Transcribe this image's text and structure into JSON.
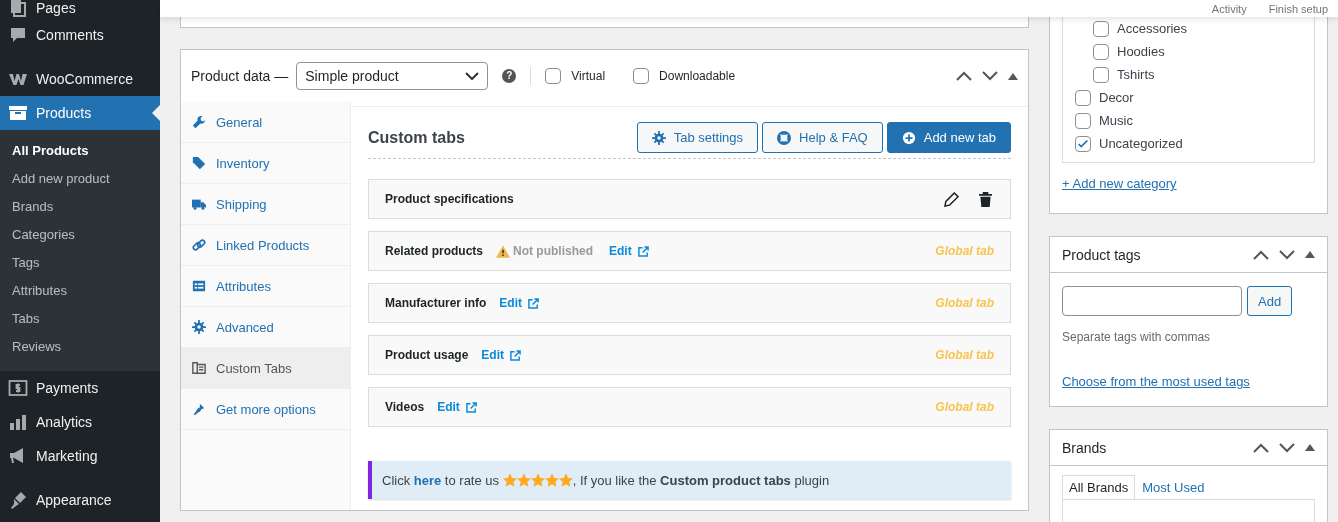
{
  "top_bar": {
    "links": [
      "Activity",
      "Finish setup"
    ]
  },
  "sidebar": {
    "items": [
      {
        "label": "Pages",
        "selected": false
      },
      {
        "label": "Comments",
        "selected": false
      },
      {
        "label": "WooCommerce",
        "selected": false
      },
      {
        "label": "Products",
        "selected": true,
        "children": [
          {
            "label": "All Products",
            "selected": true
          },
          {
            "label": "Add new product",
            "selected": false
          },
          {
            "label": "Brands",
            "selected": false
          },
          {
            "label": "Categories",
            "selected": false
          },
          {
            "label": "Tags",
            "selected": false
          },
          {
            "label": "Attributes",
            "selected": false
          },
          {
            "label": "Tabs",
            "selected": false
          },
          {
            "label": "Reviews",
            "selected": false
          }
        ]
      },
      {
        "label": "Payments",
        "selected": false
      },
      {
        "label": "Analytics",
        "selected": false
      },
      {
        "label": "Marketing",
        "selected": false
      },
      {
        "label": "Appearance",
        "selected": false
      }
    ]
  },
  "product_data": {
    "title": "Product data —",
    "product_type": "Simple product",
    "help_icon": "?",
    "options": [
      {
        "label": "Virtual",
        "checked": false
      },
      {
        "label": "Downloadable",
        "checked": false
      }
    ],
    "tabs": [
      {
        "label": "General",
        "selected": false
      },
      {
        "label": "Inventory",
        "selected": false
      },
      {
        "label": "Shipping",
        "selected": false
      },
      {
        "label": "Linked Products",
        "selected": false
      },
      {
        "label": "Attributes",
        "selected": false
      },
      {
        "label": "Advanced",
        "selected": false
      },
      {
        "label": "Custom Tabs",
        "selected": true
      },
      {
        "label": "Get more options",
        "selected": false
      }
    ],
    "panel": {
      "title": "Custom tabs",
      "buttons": [
        {
          "label": "Tab settings",
          "kind": "secondary"
        },
        {
          "label": "Help & FAQ",
          "kind": "secondary"
        },
        {
          "label": "Add new tab",
          "kind": "primary"
        }
      ],
      "custom_tabs": [
        {
          "name": "Product specifications",
          "kind": "local"
        },
        {
          "name": "Related products",
          "kind": "global",
          "status": "Not published",
          "edit": "Edit",
          "scope": "Global tab"
        },
        {
          "name": "Manufacturer info",
          "kind": "global",
          "edit": "Edit",
          "scope": "Global tab"
        },
        {
          "name": "Product usage",
          "kind": "global",
          "edit": "Edit",
          "scope": "Global tab"
        },
        {
          "name": "Videos",
          "kind": "global",
          "edit": "Edit",
          "scope": "Global tab"
        }
      ],
      "notice": {
        "before": "Click",
        "link": "here",
        "middle": "to rate us",
        "stars": 5,
        "after": ", If you like the **Custom product tabs** plugin"
      }
    }
  },
  "categories": {
    "items": [
      {
        "children": [
          {
            "label": "Accessories",
            "checked": false
          },
          {
            "label": "Hoodies",
            "checked": false
          },
          {
            "label": "Tshirts",
            "checked": false
          }
        ]
      },
      {
        "label": "Decor",
        "checked": false
      },
      {
        "label": "Music",
        "checked": false
      },
      {
        "label": "Uncategorized",
        "checked": true
      }
    ],
    "add_link": "+ Add new category"
  },
  "product_tags": {
    "title": "Product tags",
    "add_button": "Add",
    "hint": "Separate tags with commas",
    "link": "Choose from the most used tags"
  },
  "brands": {
    "title": "Brands",
    "tabs": [
      {
        "label": "All Brands",
        "selected": true
      },
      {
        "label": "Most Used",
        "selected": false
      }
    ]
  }
}
